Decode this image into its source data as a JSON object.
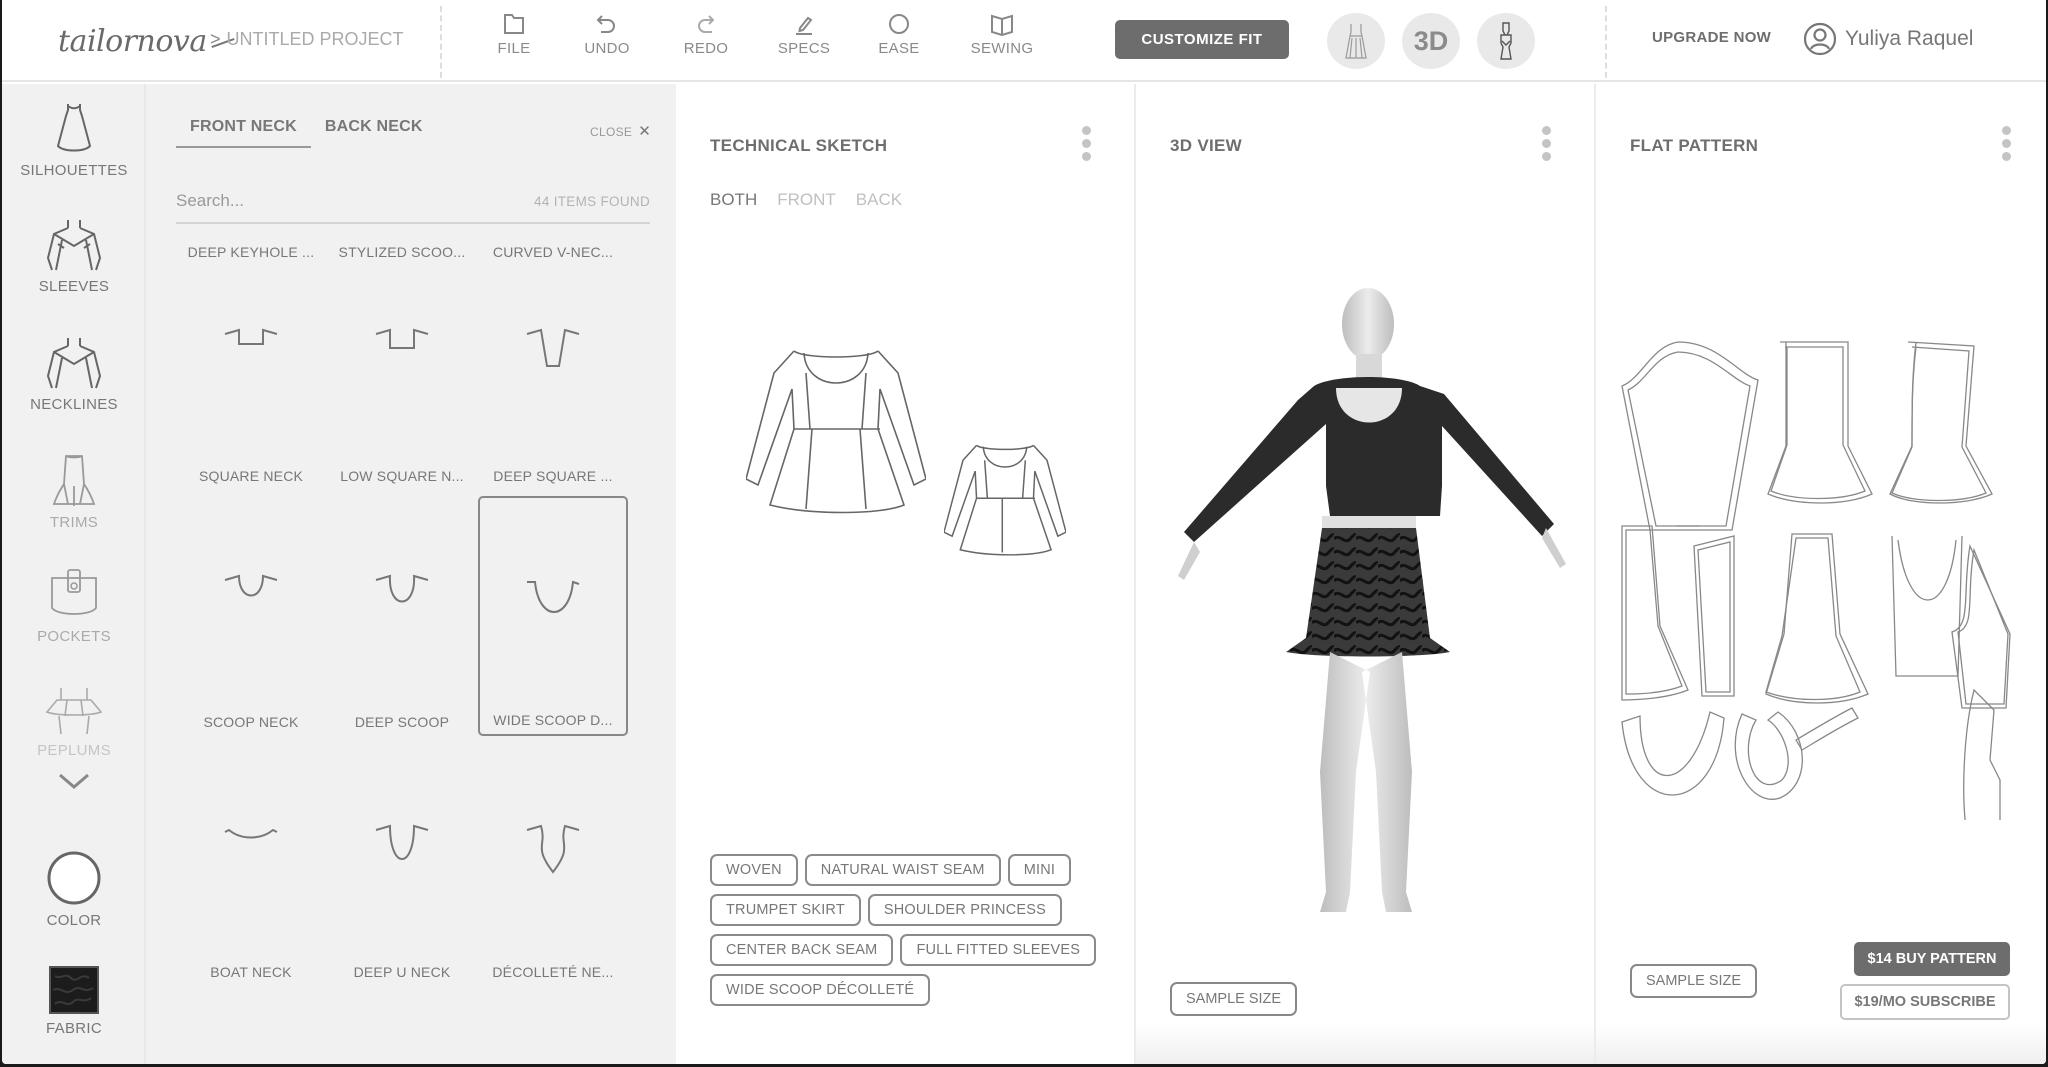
{
  "header": {
    "logo": "tailornova",
    "breadcrumb_sep": ">",
    "project_name": "UNTITLED PROJECT",
    "tools": [
      {
        "label": "FILE",
        "icon": "folder-icon"
      },
      {
        "label": "UNDO",
        "icon": "undo-icon"
      },
      {
        "label": "REDO",
        "icon": "redo-icon"
      },
      {
        "label": "SPECS",
        "icon": "pencil-icon"
      },
      {
        "label": "EASE",
        "icon": "circle-icon"
      },
      {
        "label": "SEWING",
        "icon": "book-icon"
      }
    ],
    "customize_fit": "CUSTOMIZE FIT",
    "view_modes": [
      {
        "name": "dress-view",
        "icon": "dress-icon"
      },
      {
        "name": "3d-view",
        "label": "3D"
      },
      {
        "name": "pattern-view",
        "icon": "mannequin-icon"
      }
    ],
    "upgrade": "UPGRADE NOW",
    "user_name": "Yuliya Raquel"
  },
  "sidebar": {
    "items": [
      {
        "label": "SILHOUETTES",
        "icon": "dress-silhouette-icon"
      },
      {
        "label": "SLEEVES",
        "icon": "sleeves-icon"
      },
      {
        "label": "NECKLINES",
        "icon": "neckline-icon"
      },
      {
        "label": "TRIMS",
        "icon": "trim-icon"
      },
      {
        "label": "POCKETS",
        "icon": "pocket-icon"
      },
      {
        "label": "PEPLUMS",
        "icon": "peplum-icon"
      }
    ],
    "color_label": "COLOR",
    "fabric_label": "FABRIC",
    "color_value": "#ffffff",
    "fabric_swatch": "#1c1c1c"
  },
  "necklines": {
    "tabs": [
      "FRONT NECK",
      "BACK NECK"
    ],
    "active_tab": "FRONT NECK",
    "close_label": "CLOSE",
    "search_placeholder": "Search...",
    "items_found": "44 ITEMS FOUND",
    "items": [
      {
        "name": "DEEP KEYHOLE ...",
        "shape": "none"
      },
      {
        "name": "STYLIZED SCOO...",
        "shape": "none"
      },
      {
        "name": "CURVED V-NEC...",
        "shape": "none"
      },
      {
        "name": "SQUARE NECK",
        "shape": "square"
      },
      {
        "name": "LOW SQUARE N...",
        "shape": "low-square"
      },
      {
        "name": "DEEP SQUARE ...",
        "shape": "deep-square"
      },
      {
        "name": "SCOOP NECK",
        "shape": "scoop"
      },
      {
        "name": "DEEP SCOOP",
        "shape": "deep-scoop"
      },
      {
        "name": "WIDE SCOOP D...",
        "shape": "wide-scoop",
        "selected": true
      },
      {
        "name": "BOAT NECK",
        "shape": "boat"
      },
      {
        "name": "DEEP U NECK",
        "shape": "deep-u"
      },
      {
        "name": "DÉCOLLETÉ NE...",
        "shape": "decollete"
      }
    ]
  },
  "technical_sketch": {
    "title": "TECHNICAL SKETCH",
    "subtabs": [
      "BOTH",
      "FRONT",
      "BACK"
    ],
    "active_subtab": "BOTH",
    "tags": [
      [
        "WOVEN",
        "NATURAL WAIST SEAM",
        "MINI"
      ],
      [
        "TRUMPET SKIRT",
        "SHOULDER PRINCESS"
      ],
      [
        "CENTER BACK SEAM",
        "FULL FITTED SLEEVES"
      ],
      [
        "WIDE SCOOP DÉCOLLETÉ"
      ]
    ]
  },
  "view_3d": {
    "title": "3D VIEW",
    "sample_size": "SAMPLE SIZE"
  },
  "flat_pattern": {
    "title": "FLAT PATTERN",
    "sample_size": "SAMPLE SIZE",
    "buy": "$14 BUY PATTERN",
    "subscribe": "$19/MO SUBSCRIBE"
  }
}
